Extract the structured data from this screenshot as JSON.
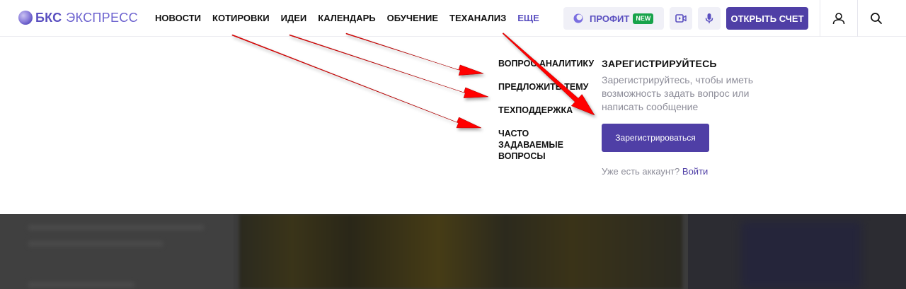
{
  "header": {
    "logo_brand": "БКС",
    "logo_product": "ЭКСПРЕСС",
    "nav": [
      {
        "label": "НОВОСТИ"
      },
      {
        "label": "КОТИРОВКИ"
      },
      {
        "label": "ИДЕИ"
      },
      {
        "label": "КАЛЕНДАРЬ"
      },
      {
        "label": "ОБУЧЕНИЕ"
      },
      {
        "label": "ТЕХАНАЛИЗ"
      },
      {
        "label": "ЕЩЕ"
      }
    ],
    "profit_label": "ПРОФИТ",
    "new_badge": "NEW",
    "open_account_label": "ОТКРЫТЬ СЧЕТ"
  },
  "dropdown": {
    "menu": [
      {
        "label": "ВОПРОС АНАЛИТИКУ"
      },
      {
        "label": "ПРЕДЛОЖИТЬ ТЕМУ"
      },
      {
        "label": "ТЕХПОДДЕРЖКА"
      },
      {
        "label": "ЧАСТО ЗАДАВАЕМЫЕ ВОПРОСЫ"
      }
    ],
    "register": {
      "title": "ЗАРЕГИСТРИРУЙТЕСЬ",
      "description": "Зарегистрируйтесь, чтобы иметь возможность задать вопрос или написать сообщение",
      "button_label": "Зарегистрироваться",
      "have_account": "Уже есть аккаунт?",
      "login_label": "Войти"
    }
  },
  "colors": {
    "accent": "#4f3fa6",
    "brand": "#5a4fc0",
    "new_badge": "#17a34a",
    "annotation_arrow": "#ff0000"
  },
  "icons": [
    "bks-logo-icon",
    "profit-icon",
    "video-icon",
    "microphone-icon",
    "user-icon",
    "search-icon",
    "annotation-arrow"
  ]
}
